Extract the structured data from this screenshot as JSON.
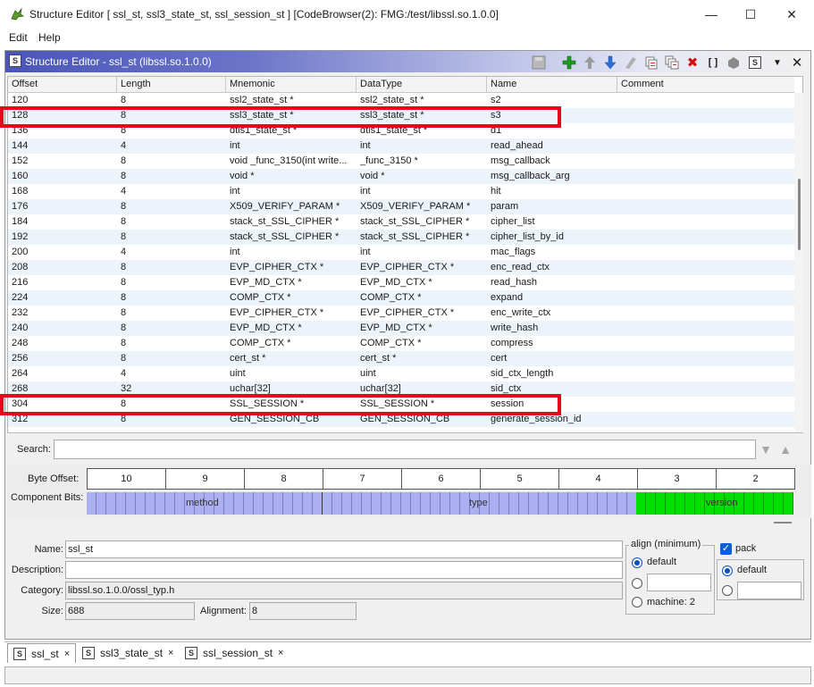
{
  "window": {
    "title": "Structure Editor [ ssl_st, ssl3_state_st, ssl_session_st ] [CodeBrowser(2): FMG:/test/libssl.so.1.0.0]",
    "minimize": "—",
    "maximize": "☐",
    "close": "✕"
  },
  "menu": {
    "edit": "Edit",
    "help": "Help"
  },
  "panel": {
    "title": "Structure Editor - ssl_st (libssl.so.1.0.0)",
    "toolbar_icons": [
      "save-icon",
      "add-icon",
      "move-up-icon",
      "move-down-icon",
      "clear-icon",
      "duplicate-icon",
      "duplicate-multiple-icon",
      "delete-icon",
      "array-icon",
      "unpack-icon",
      "edit-structure-icon",
      "menu-icon",
      "close-icon"
    ]
  },
  "table": {
    "columns": [
      "Offset",
      "Length",
      "Mnemonic",
      "DataType",
      "Name",
      "Comment"
    ],
    "rows": [
      {
        "offset": "120",
        "length": "8",
        "mnemonic": "ssl2_state_st *",
        "datatype": "ssl2_state_st *",
        "name": "s2",
        "comment": ""
      },
      {
        "offset": "128",
        "length": "8",
        "mnemonic": "ssl3_state_st *",
        "datatype": "ssl3_state_st *",
        "name": "s3",
        "comment": ""
      },
      {
        "offset": "136",
        "length": "8",
        "mnemonic": "dtls1_state_st *",
        "datatype": "dtls1_state_st *",
        "name": "d1",
        "comment": ""
      },
      {
        "offset": "144",
        "length": "4",
        "mnemonic": "int",
        "datatype": "int",
        "name": "read_ahead",
        "comment": ""
      },
      {
        "offset": "152",
        "length": "8",
        "mnemonic": "void _func_3150(int write...",
        "datatype": "_func_3150 *",
        "name": "msg_callback",
        "comment": ""
      },
      {
        "offset": "160",
        "length": "8",
        "mnemonic": "void *",
        "datatype": "void *",
        "name": "msg_callback_arg",
        "comment": ""
      },
      {
        "offset": "168",
        "length": "4",
        "mnemonic": "int",
        "datatype": "int",
        "name": "hit",
        "comment": ""
      },
      {
        "offset": "176",
        "length": "8",
        "mnemonic": "X509_VERIFY_PARAM *",
        "datatype": "X509_VERIFY_PARAM *",
        "name": "param",
        "comment": ""
      },
      {
        "offset": "184",
        "length": "8",
        "mnemonic": "stack_st_SSL_CIPHER *",
        "datatype": "stack_st_SSL_CIPHER *",
        "name": "cipher_list",
        "comment": ""
      },
      {
        "offset": "192",
        "length": "8",
        "mnemonic": "stack_st_SSL_CIPHER *",
        "datatype": "stack_st_SSL_CIPHER *",
        "name": "cipher_list_by_id",
        "comment": ""
      },
      {
        "offset": "200",
        "length": "4",
        "mnemonic": "int",
        "datatype": "int",
        "name": "mac_flags",
        "comment": ""
      },
      {
        "offset": "208",
        "length": "8",
        "mnemonic": "EVP_CIPHER_CTX *",
        "datatype": "EVP_CIPHER_CTX *",
        "name": "enc_read_ctx",
        "comment": ""
      },
      {
        "offset": "216",
        "length": "8",
        "mnemonic": "EVP_MD_CTX *",
        "datatype": "EVP_MD_CTX *",
        "name": "read_hash",
        "comment": ""
      },
      {
        "offset": "224",
        "length": "8",
        "mnemonic": "COMP_CTX *",
        "datatype": "COMP_CTX *",
        "name": "expand",
        "comment": ""
      },
      {
        "offset": "232",
        "length": "8",
        "mnemonic": "EVP_CIPHER_CTX *",
        "datatype": "EVP_CIPHER_CTX *",
        "name": "enc_write_ctx",
        "comment": ""
      },
      {
        "offset": "240",
        "length": "8",
        "mnemonic": "EVP_MD_CTX *",
        "datatype": "EVP_MD_CTX *",
        "name": "write_hash",
        "comment": ""
      },
      {
        "offset": "248",
        "length": "8",
        "mnemonic": "COMP_CTX *",
        "datatype": "COMP_CTX *",
        "name": "compress",
        "comment": ""
      },
      {
        "offset": "256",
        "length": "8",
        "mnemonic": "cert_st *",
        "datatype": "cert_st *",
        "name": "cert",
        "comment": ""
      },
      {
        "offset": "264",
        "length": "4",
        "mnemonic": "uint",
        "datatype": "uint",
        "name": "sid_ctx_length",
        "comment": ""
      },
      {
        "offset": "268",
        "length": "32",
        "mnemonic": "uchar[32]",
        "datatype": "uchar[32]",
        "name": "sid_ctx",
        "comment": ""
      },
      {
        "offset": "304",
        "length": "8",
        "mnemonic": "SSL_SESSION *",
        "datatype": "SSL_SESSION *",
        "name": "session",
        "comment": ""
      },
      {
        "offset": "312",
        "length": "8",
        "mnemonic": "GEN_SESSION_CB",
        "datatype": "GEN_SESSION_CB",
        "name": "generate_session_id",
        "comment": ""
      }
    ],
    "highlighted_offsets": [
      "128",
      "304"
    ],
    "highlight_color": "#e8061a"
  },
  "search": {
    "label": "Search:",
    "value": ""
  },
  "bits": {
    "byte_offset_label": "Byte Offset:",
    "component_bits_label": "Component Bits:",
    "bytes": [
      "10",
      "9",
      "8",
      "7",
      "6",
      "5",
      "4",
      "3",
      "2"
    ],
    "fields": [
      "method",
      "type",
      "version"
    ],
    "colors": {
      "method": "#aab0f0",
      "type": "#aab0f0",
      "version": "#00e000"
    }
  },
  "info": {
    "name_label": "Name:",
    "name": "ssl_st",
    "description_label": "Description:",
    "description": "",
    "category_label": "Category:",
    "category": "libssl.so.1.0.0/ossl_typ.h",
    "size_label": "Size:",
    "size": "688",
    "alignment_label": "Alignment:",
    "alignment": "8",
    "align_group_label": "align (minimum)",
    "align_default": "default",
    "align_machine": "machine: 2",
    "pack_label": "pack",
    "pack_default": "default"
  },
  "tabs": [
    {
      "label": "ssl_st",
      "close": "×"
    },
    {
      "label": "ssl3_state_st",
      "close": "×"
    },
    {
      "label": "ssl_session_st",
      "close": "×"
    }
  ]
}
